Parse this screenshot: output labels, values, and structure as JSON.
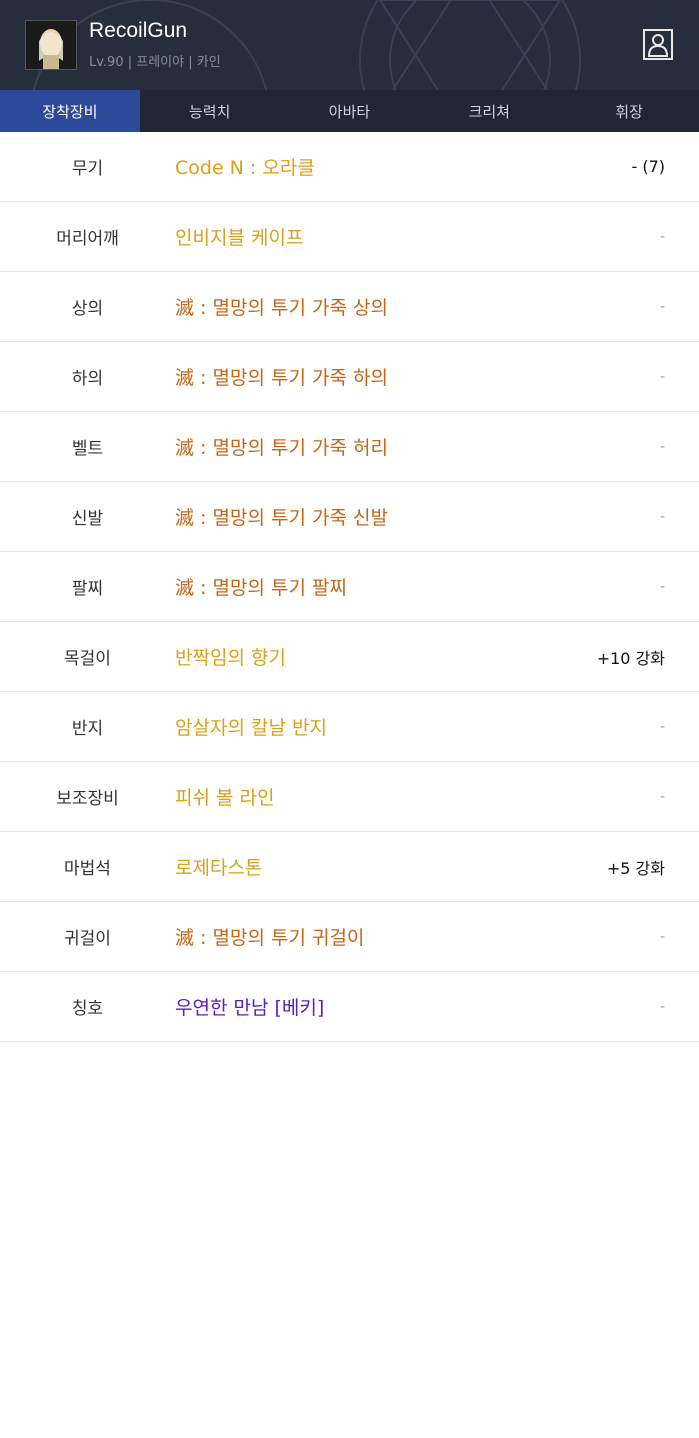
{
  "header": {
    "character_name": "RecoilGun",
    "character_info": "Lv.90 | 프레이야 | 카인"
  },
  "tabs": [
    {
      "label": "장착장비",
      "active": true
    },
    {
      "label": "능력치",
      "active": false
    },
    {
      "label": "아바타",
      "active": false
    },
    {
      "label": "크리쳐",
      "active": false
    },
    {
      "label": "휘장",
      "active": false
    }
  ],
  "colors": {
    "header_bg": "#262d3b",
    "tab_bar_bg": "#1f2634",
    "tab_active_bg": "#2d4a9a",
    "rarity_unique": "#d9a01a",
    "rarity_epic": "#c4661a",
    "rarity_rare": "#5a1ac4"
  },
  "equipment": [
    {
      "slot": "무기",
      "item": "Code N : 오라클",
      "value": "- (7)",
      "rarity": "unique"
    },
    {
      "slot": "머리어깨",
      "item": "인비지블 케이프",
      "value": "-",
      "rarity": "unique"
    },
    {
      "slot": "상의",
      "item": "滅 : 멸망의 투기 가죽 상의",
      "value": "-",
      "rarity": "epic"
    },
    {
      "slot": "하의",
      "item": "滅 : 멸망의 투기 가죽 하의",
      "value": "-",
      "rarity": "epic"
    },
    {
      "slot": "벨트",
      "item": "滅 : 멸망의 투기 가죽 허리",
      "value": "-",
      "rarity": "epic"
    },
    {
      "slot": "신발",
      "item": "滅 : 멸망의 투기 가죽 신발",
      "value": "-",
      "rarity": "epic"
    },
    {
      "slot": "팔찌",
      "item": "滅 : 멸망의 투기 팔찌",
      "value": "-",
      "rarity": "epic"
    },
    {
      "slot": "목걸이",
      "item": "반짝임의 향기",
      "value": "+10 강화",
      "rarity": "unique"
    },
    {
      "slot": "반지",
      "item": "암살자의 칼날 반지",
      "value": "-",
      "rarity": "unique"
    },
    {
      "slot": "보조장비",
      "item": "피쉬 볼 라인",
      "value": "-",
      "rarity": "unique"
    },
    {
      "slot": "마법석",
      "item": "로제타스톤",
      "value": "+5 강화",
      "rarity": "unique"
    },
    {
      "slot": "귀걸이",
      "item": "滅 : 멸망의 투기 귀걸이",
      "value": "-",
      "rarity": "epic"
    },
    {
      "slot": "칭호",
      "item": "우연한 만남 [베키]",
      "value": "-",
      "rarity": "rare"
    }
  ]
}
